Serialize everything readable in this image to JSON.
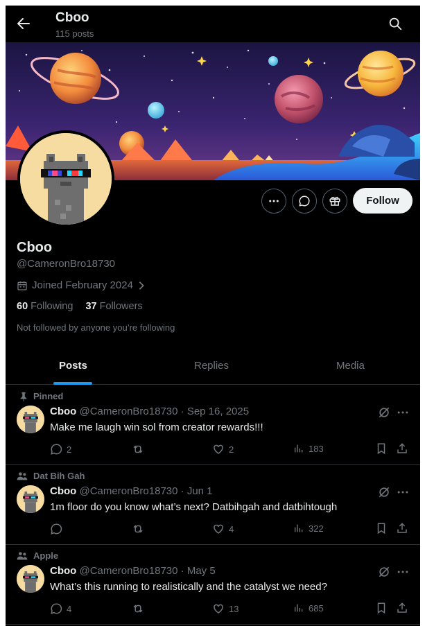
{
  "header": {
    "title": "Cboo",
    "subtitle": "115 posts"
  },
  "profile": {
    "name": "Cboo",
    "handle": "@CameronBro18730",
    "joined": "Joined February 2024",
    "following_count": "60",
    "following_label": "Following",
    "followers_count": "37",
    "followers_label": "Followers",
    "not_followed": "Not followed by anyone you’re following",
    "follow_label": "Follow"
  },
  "tabs": [
    {
      "label": "Posts",
      "active": true
    },
    {
      "label": "Replies",
      "active": false
    },
    {
      "label": "Media",
      "active": false
    }
  ],
  "posts": [
    {
      "context": "Pinned",
      "context_icon": "pin-icon",
      "name": "Cboo",
      "handle": "@CameronBro18730",
      "date": "· Sep 16, 2025",
      "text": "Make me laugh win sol from creator rewards!!!",
      "replies": "2",
      "reposts": "",
      "likes": "2",
      "views": "183"
    },
    {
      "context": "Dat Bih Gah",
      "context_icon": "community-icon",
      "name": "Cboo",
      "handle": "@CameronBro18730",
      "date": "· Jun 1",
      "text": "1m floor do you know what’s next? Datbihgah and datbihtough",
      "replies": "",
      "reposts": "",
      "likes": "4",
      "views": "322"
    },
    {
      "context": "Apple",
      "context_icon": "community-icon",
      "name": "Cboo",
      "handle": "@CameronBro18730",
      "date": "· May 5",
      "text": "What’s this running to realistically and the catalyst we need?",
      "replies": "4",
      "reposts": "",
      "likes": "13",
      "views": "685"
    }
  ],
  "colors": {
    "accent": "#1d9bf0",
    "background": "#000000",
    "muted": "#71767b"
  }
}
